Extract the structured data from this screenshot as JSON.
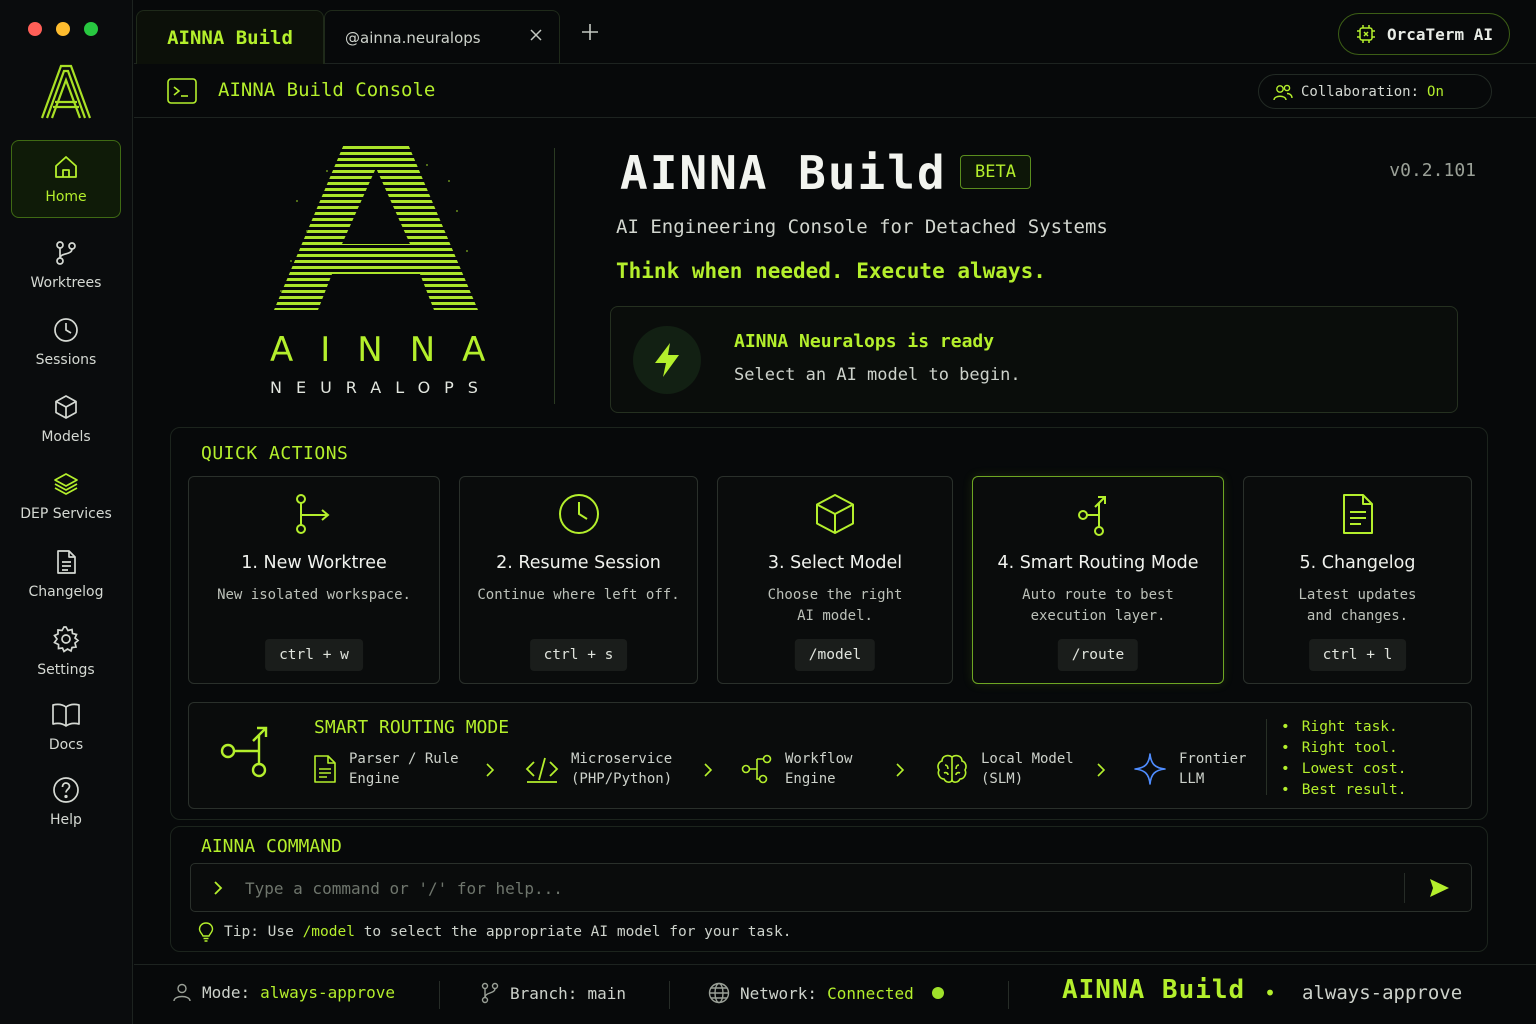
{
  "window": {
    "traffic_lights": [
      "#ff5f57",
      "#febc2e",
      "#28c840"
    ],
    "accent": "#b4ef2c"
  },
  "sidebar": {
    "logo": "A",
    "items": [
      {
        "label": "Home",
        "icon": "home-icon",
        "active": true
      },
      {
        "label": "Worktrees",
        "icon": "git-branch-icon"
      },
      {
        "label": "Sessions",
        "icon": "clock-icon"
      },
      {
        "label": "Models",
        "icon": "cube-icon"
      },
      {
        "label": "DEP Services",
        "icon": "layers-icon"
      },
      {
        "label": "Changelog",
        "icon": "document-icon"
      },
      {
        "label": "Settings",
        "icon": "gear-icon"
      },
      {
        "label": "Docs",
        "icon": "book-icon"
      },
      {
        "label": "Help",
        "icon": "help-icon"
      }
    ]
  },
  "tabs": [
    {
      "label": "AINNA Build",
      "active": true
    },
    {
      "label": "@ainna.neuralops",
      "closable": true
    }
  ],
  "orcaterm": {
    "label": "OrcaTerm AI"
  },
  "console": {
    "title": "AINNA Build Console",
    "collab_label": "Collaboration:",
    "collab_value": "On"
  },
  "hero": {
    "brand_word": "AINNA",
    "brand_sub": "NEURALOPS",
    "title": "AINNA Build",
    "badge": "BETA",
    "version": "v0.2.101",
    "subtitle": "AI Engineering Console for Detached Systems",
    "tagline": "Think when needed. Execute always.",
    "ready_title": "AINNA Neuralops is ready",
    "ready_sub": "Select an AI model to begin."
  },
  "quick_actions": {
    "heading": "QUICK ACTIONS",
    "cards": [
      {
        "title": "1. New Worktree",
        "desc": "New isolated workspace.",
        "key": "ctrl + w",
        "icon": "worktree-icon"
      },
      {
        "title": "2. Resume Session",
        "desc": "Continue where left off.",
        "key": "ctrl + s",
        "icon": "clock-icon"
      },
      {
        "title": "3. Select Model",
        "desc": "Choose the right AI model.",
        "key": "/model",
        "icon": "cube-icon"
      },
      {
        "title": "4. Smart Routing Mode",
        "desc": "Auto route to best execution layer.",
        "key": "/route",
        "icon": "routing-icon",
        "highlighted": true
      },
      {
        "title": "5. Changelog",
        "desc": "Latest updates and changes.",
        "key": "ctrl + l",
        "icon": "document-icon"
      }
    ]
  },
  "smart_routing": {
    "title": "SMART ROUTING MODE",
    "steps": [
      {
        "line1": "Parser / Rule",
        "line2": "Engine",
        "icon": "document-icon"
      },
      {
        "line1": "Microservice",
        "line2": "(PHP/Python)",
        "icon": "code-icon"
      },
      {
        "line1": "Workflow",
        "line2": "Engine",
        "icon": "workflow-icon"
      },
      {
        "line1": "Local Model",
        "line2": "(SLM)",
        "icon": "brain-icon"
      },
      {
        "line1": "Frontier",
        "line2": "LLM",
        "icon": "sparkle-icon"
      }
    ],
    "bullets": [
      "Right task.",
      "Right tool.",
      "Lowest cost.",
      "Best result."
    ]
  },
  "command": {
    "heading": "AINNA COMMAND",
    "placeholder": "Type a command or '/' for help...",
    "tip_prefix": "Tip: Use",
    "tip_cmd": "/model",
    "tip_suffix": "to select the appropriate AI model for your task."
  },
  "status": {
    "mode_label": "Mode:",
    "mode_value": "always-approve",
    "branch_label": "Branch:",
    "branch_value": "main",
    "network_label": "Network:",
    "network_value": "Connected",
    "brand": "AINNA Build",
    "separator": "•",
    "mode_right": "always-approve"
  }
}
